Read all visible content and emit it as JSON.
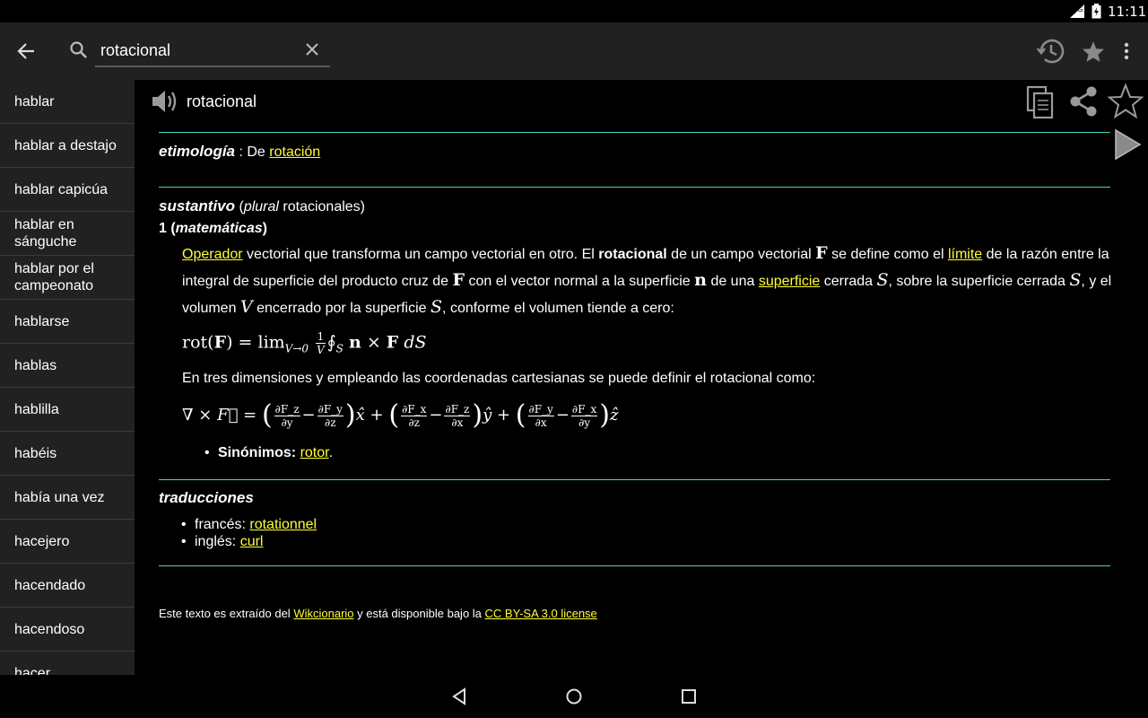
{
  "status_bar": {
    "network": "3G",
    "time": "11:11"
  },
  "search": {
    "value": "rotacional",
    "placeholder": ""
  },
  "sidebar": {
    "items": [
      {
        "label": "hablar"
      },
      {
        "label": "hablar a destajo"
      },
      {
        "label": "hablar capicúa"
      },
      {
        "label": "hablar en sánguche"
      },
      {
        "label": "hablar por el campeonato"
      },
      {
        "label": "hablarse"
      },
      {
        "label": "hablas"
      },
      {
        "label": "hablilla"
      },
      {
        "label": "habéis"
      },
      {
        "label": "había una vez"
      },
      {
        "label": "hacejero"
      },
      {
        "label": "hacendado"
      },
      {
        "label": "hacendoso"
      },
      {
        "label": "hacer"
      }
    ]
  },
  "entry": {
    "headword": "rotacional",
    "etymology": {
      "label": "etimología",
      "text": ": De",
      "link": "rotación"
    },
    "noun": {
      "pos": "sustantivo",
      "open_paren": "(",
      "plural_label": "plural",
      "plural_value": "rotacionales)",
      "sense_number": "1 (",
      "sense_domain": "matemáticas",
      "sense_close": ")"
    },
    "definition": {
      "link_operador": "Operador",
      "t1": "vectorial que transforma un campo vectorial en otro. El",
      "bold_rotacional": "rotacional",
      "t2": "de un campo vectorial",
      "sym_F": "F",
      "t3": "se define como el",
      "link_limite": "límite",
      "t4": "de la razón entre la integral de superficie del producto cruz de",
      "t5": "con el vector normal a la superficie",
      "sym_n": "n",
      "t6": "de una",
      "link_superficie": "superficie",
      "t7": "cerrada",
      "sym_S": "S",
      "t8": ", sobre la superficie cerrada",
      "t9": ", y el volumen",
      "sym_V": "V",
      "t10": "encerrado por la superficie",
      "t11": ", conforme el volumen tiende a cero:"
    },
    "formula1": {
      "rot": "rot(",
      "F": "F",
      "eq": ") = lim",
      "sub": "V→0",
      "frac_num": "1",
      "frac_den": "V",
      "oint": "∮",
      "oint_sub": "S",
      "n": "n",
      "times": "×",
      "F2": "F",
      "dS": "dS"
    },
    "cartesian_text": "En tres dimensiones y empleando las coordenadas cartesianas se puede definir el rotacional como:",
    "formula2": {
      "lhs": "∇ × F⃗ =",
      "f1n": "∂F_z",
      "f1d": "∂y",
      "f2n": "∂F_y",
      "f2d": "∂z",
      "u1": "x̂",
      "f3n": "∂F_x",
      "f3d": "∂z",
      "f4n": "∂F_z",
      "f4d": "∂x",
      "u2": "ŷ",
      "f5n": "∂F_y",
      "f5d": "∂x",
      "f6n": "∂F_x",
      "f6d": "∂y",
      "u3": "ẑ",
      "minus": "−",
      "plus": "+",
      "lp": "(",
      "rp": ")"
    },
    "synonyms": {
      "label": "Sinónimos:",
      "link": "rotor",
      "end": "."
    },
    "translations": {
      "title": "traducciones",
      "items": [
        {
          "lang": "francés:",
          "word": "rotationnel"
        },
        {
          "lang": "inglés:",
          "word": "curl"
        }
      ]
    },
    "footer": {
      "t1": "Este texto es extraído del",
      "link1": "Wikcionario",
      "t2": "y está disponible bajo la",
      "link2": "CC BY-SA 3.0 license"
    }
  },
  "colors": {
    "accent_line": "#4dd0c4",
    "link": "#ffff33",
    "toolbar": "#212121"
  }
}
